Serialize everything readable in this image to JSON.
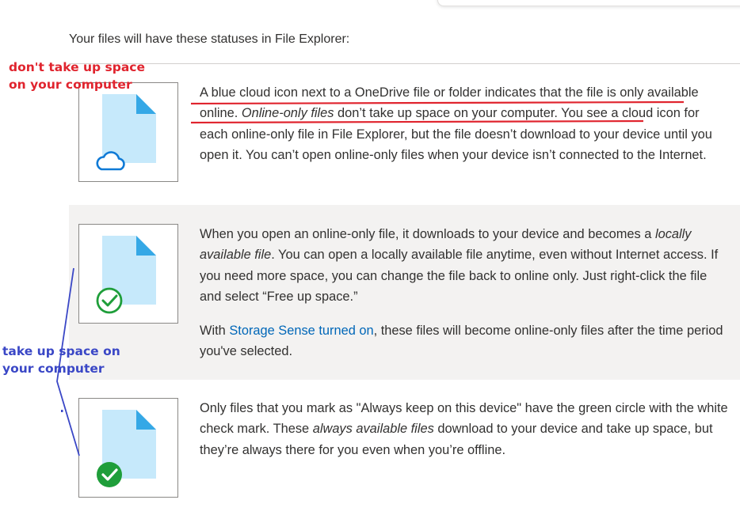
{
  "intro_text": "Your files will have these statuses in File Explorer:",
  "colors": {
    "accent_link": "#0067b8",
    "annotation_red": "#e0242e",
    "annotation_blue": "#3a47c6",
    "row_highlight": "#f3f2f1",
    "file_icon": "#c6e9fb",
    "file_corner": "#35a8e6",
    "cloud": "#0f7ad6",
    "check_green": "#1f9e3a"
  },
  "statuses": [
    {
      "icon": "online-only-cloud-icon",
      "parts": [
        "A blue cloud icon next to a OneDrive file or folder indicates that the file is only available online. ",
        "Online-only files",
        " don’t take up space on your computer. You see a cloud icon for each online-only file in File Explorer, but the file doesn’t download to your device until you open it. You can’t open online-only files when your device isn’t connected to the Internet."
      ]
    },
    {
      "icon": "locally-available-check-outline-icon",
      "parts": [
        "When you open an online-only file, it downloads to your device and becomes a ",
        "locally available file",
        ". You can open a locally available file anytime, even without Internet access. If you need more space, you can change the file back to online only. Just right-click the file and select “Free up space.”"
      ],
      "extra": {
        "before": "With ",
        "link": "Storage Sense turned on",
        "after": ", these files will become online-only files after the time period you've selected."
      }
    },
    {
      "icon": "always-available-check-filled-icon",
      "parts": [
        "Only files that you mark as \"Always keep on this device\" have the green circle with the white check mark. These ",
        "always available files",
        " download to your device and take up space, but they’re always there for you even when you’re offline."
      ]
    }
  ],
  "annotations": {
    "red_label": "don't take up space on your computer",
    "blue_label": "take up space on your computer"
  }
}
